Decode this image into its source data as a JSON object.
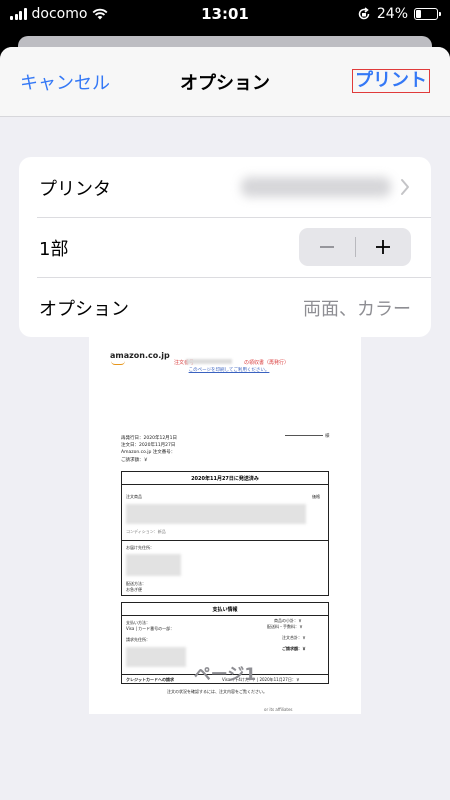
{
  "status_bar": {
    "carrier": "docomo",
    "time": "13:01",
    "battery_percent": "24%",
    "battery_level": 0.24
  },
  "nav": {
    "cancel_label": "キャンセル",
    "title": "オプション",
    "print_label": "プリント",
    "accent_color": "#3478f6"
  },
  "settings": {
    "printer_label": "プリンタ",
    "copies_label": "1部",
    "copies_value": 1,
    "stepper_minus": "−",
    "stepper_plus": "+",
    "options_label": "オプション",
    "options_value": "両面、カラー"
  },
  "preview": {
    "page_label": "ページ1",
    "document": {
      "logo": "amazon.co.jp",
      "order_title_prefix": "注文番号",
      "order_title_suffix": "の領収書（再発行）",
      "print_link": "このページを印刷してご利用ください。",
      "reissue_date": "再発行日：2020年12月1日",
      "order_date": "注文日：2020年11月27日",
      "order_number_label": "Amazon.co.jp 注文番号：",
      "total_label": "ご請求額：￥",
      "sama": "様",
      "shipped_title": "2020年11月27日に発送済み",
      "item_header": "注文商品",
      "price_header": "価格",
      "condition": "コンディション：新品",
      "ship_to": "お届け先住所：",
      "ship_method": "配送方法：",
      "ship_method_value": "お急ぎ便",
      "payment_title": "支払い情報",
      "payment_method": "支払い方法：",
      "card_line": "Visa | カード番号の一部：",
      "subtotal": "商品の小計：￥",
      "shipping_fee": "配送料・手数料：￥",
      "billing_address": "請求先住所：",
      "order_total": "注文合計：￥",
      "grand_total": "ご請求額：￥",
      "card_charge": "クレジットカードへの請求",
      "card_charge_detail": "Visa（下4けた：）| 2020年11月27日：￥",
      "check_status": "注文の状況を確認するには、注文内容をご覧ください。",
      "footer_affiliates": "or its affiliates"
    }
  }
}
